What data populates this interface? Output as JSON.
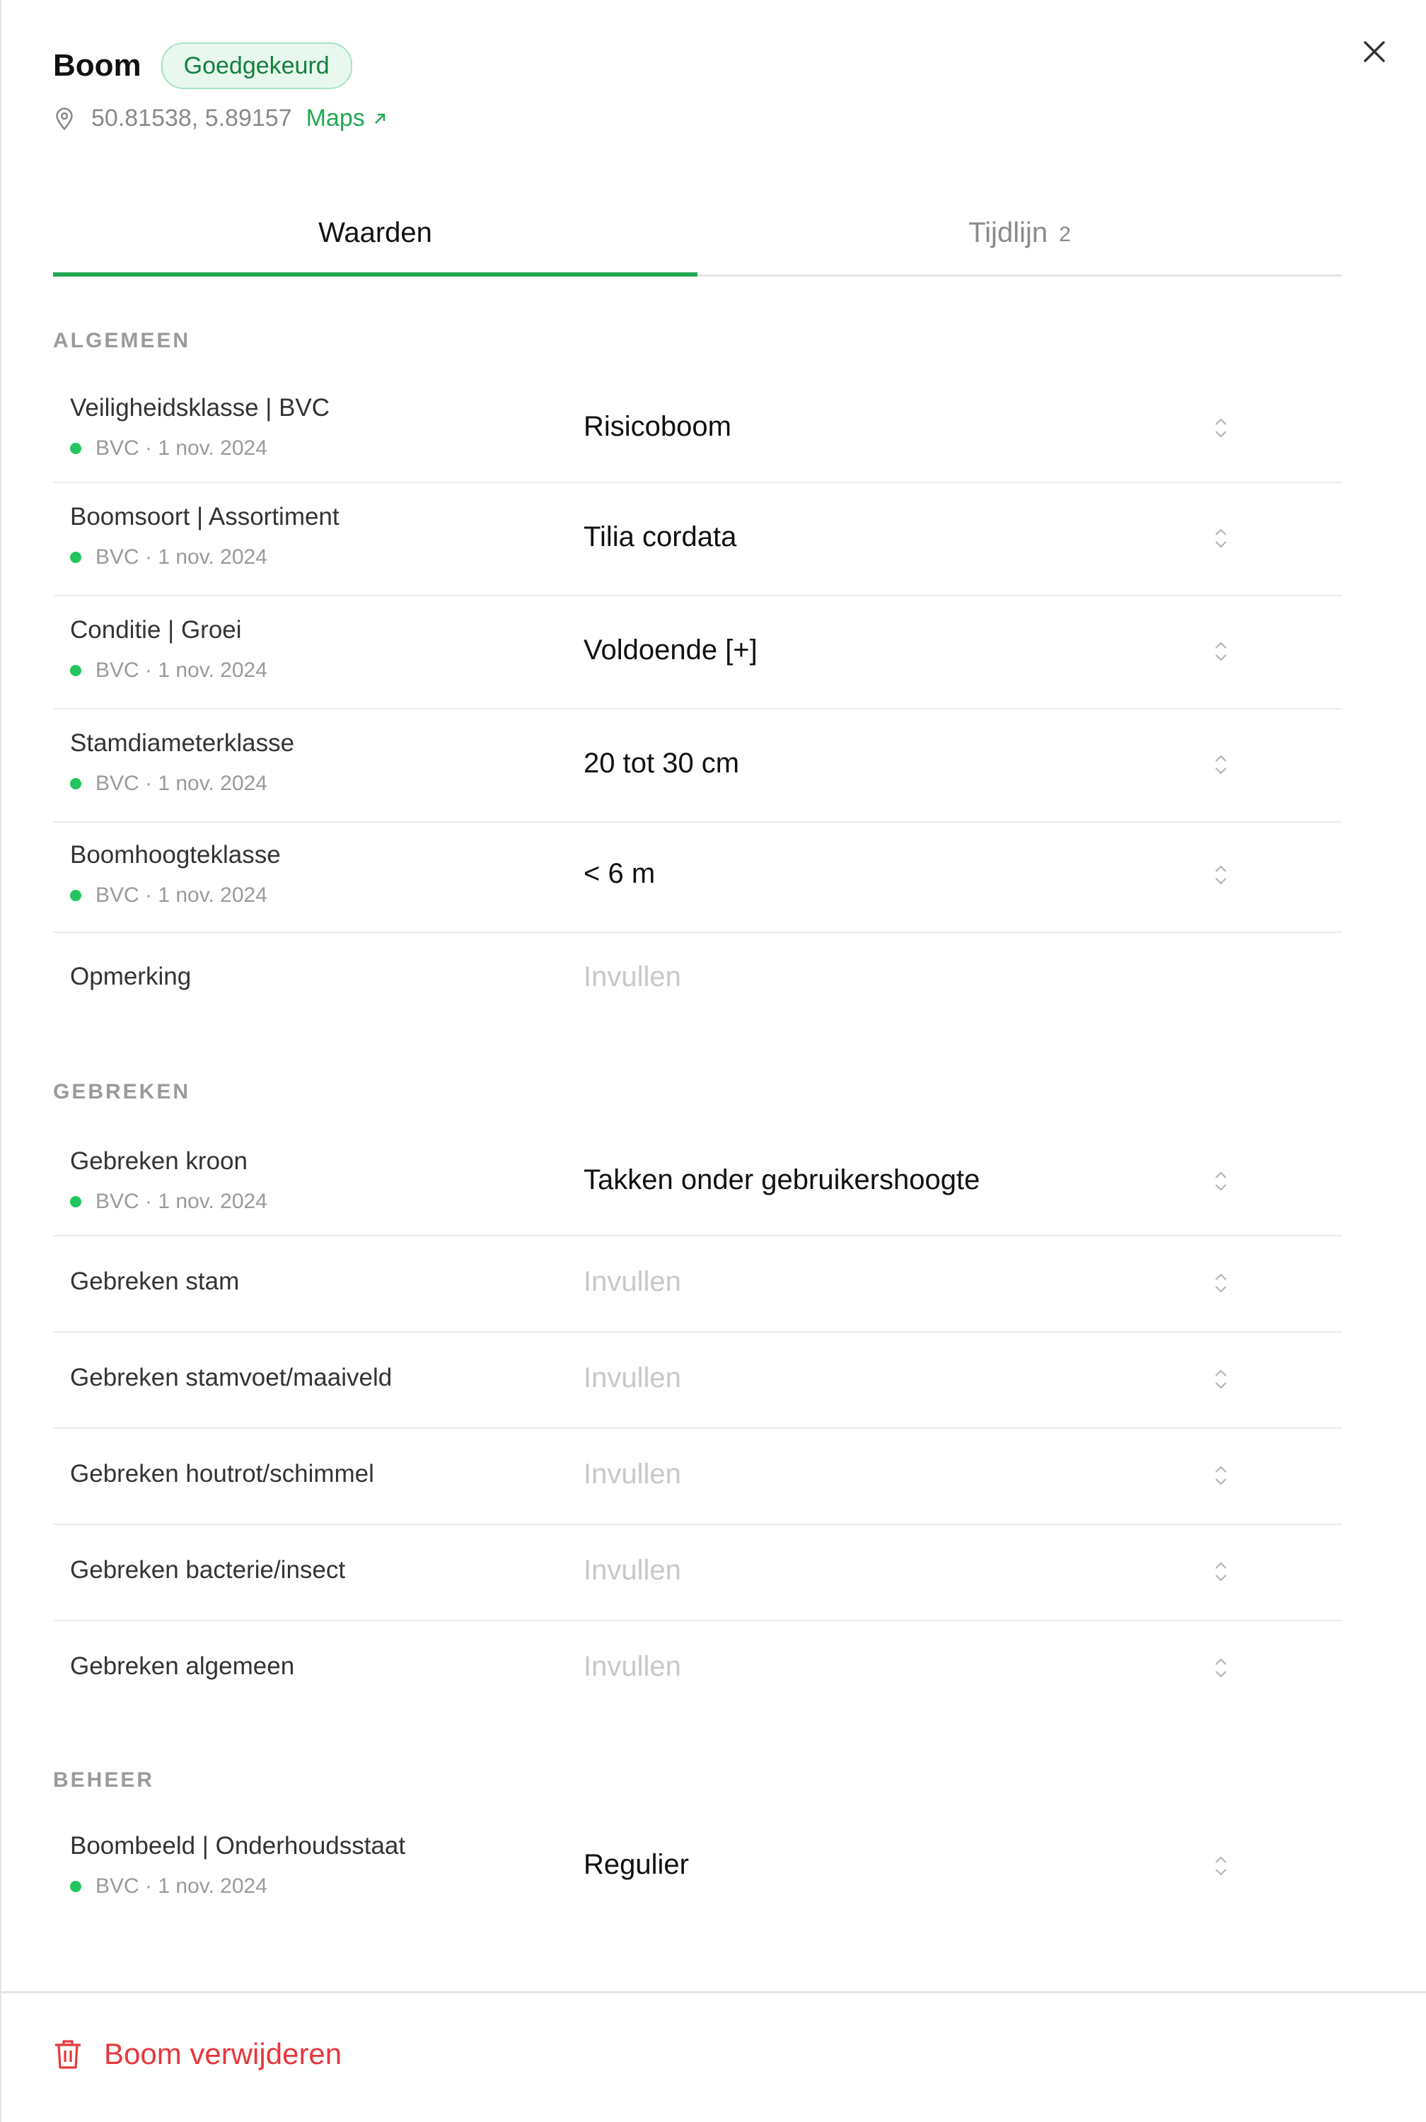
{
  "header": {
    "title": "Boom",
    "badge": "Goedgekeurd",
    "coordinates": "50.81538, 5.89157",
    "maps_label": "Maps"
  },
  "tabs": [
    {
      "label": "Waarden",
      "active": true
    },
    {
      "label": "Tijdlijn",
      "count": "2",
      "active": false
    }
  ],
  "sections": {
    "algemeen": {
      "title": "ALGEMEEN",
      "rows": [
        {
          "label": "Veiligheidsklasse | BVC",
          "meta": "BVC · 1 nov. 2024",
          "value": "Risicoboom"
        },
        {
          "label": "Boomsoort | Assortiment",
          "meta": "BVC · 1 nov. 2024",
          "value": "Tilia cordata"
        },
        {
          "label": "Conditie | Groei",
          "meta": "BVC · 1 nov. 2024",
          "value": "Voldoende [+]"
        },
        {
          "label": "Stamdiameterklasse",
          "meta": "BVC · 1 nov. 2024",
          "value": "20 tot 30 cm"
        },
        {
          "label": "Boomhoogteklasse",
          "meta": "BVC · 1 nov. 2024",
          "value": "< 6 m"
        },
        {
          "label": "Opmerking",
          "placeholder": "Invullen"
        }
      ]
    },
    "gebreken": {
      "title": "GEBREKEN",
      "rows": [
        {
          "label": "Gebreken kroon",
          "meta": "BVC · 1 nov. 2024",
          "value": "Takken onder gebruikershoogte"
        },
        {
          "label": "Gebreken stam",
          "placeholder": "Invullen"
        },
        {
          "label": "Gebreken stamvoet/maaiveld",
          "placeholder": "Invullen"
        },
        {
          "label": "Gebreken houtrot/schimmel",
          "placeholder": "Invullen"
        },
        {
          "label": "Gebreken bacterie/insect",
          "placeholder": "Invullen"
        },
        {
          "label": "Gebreken algemeen",
          "placeholder": "Invullen"
        }
      ]
    },
    "beheer": {
      "title": "BEHEER",
      "rows": [
        {
          "label": "Boombeeld | Onderhoudsstaat",
          "meta": "BVC · 1 nov. 2024",
          "value": "Regulier"
        }
      ]
    }
  },
  "footer": {
    "delete_label": "Boom verwijderen"
  },
  "colors": {
    "accent": "#22a852",
    "status_dot": "#22c55e",
    "danger": "#e5383b",
    "badge_bg": "#e8f8ef"
  },
  "icons": [
    "location-pin-icon",
    "external-arrow-icon",
    "close-icon",
    "chevron-updown-icon",
    "trash-icon"
  ]
}
